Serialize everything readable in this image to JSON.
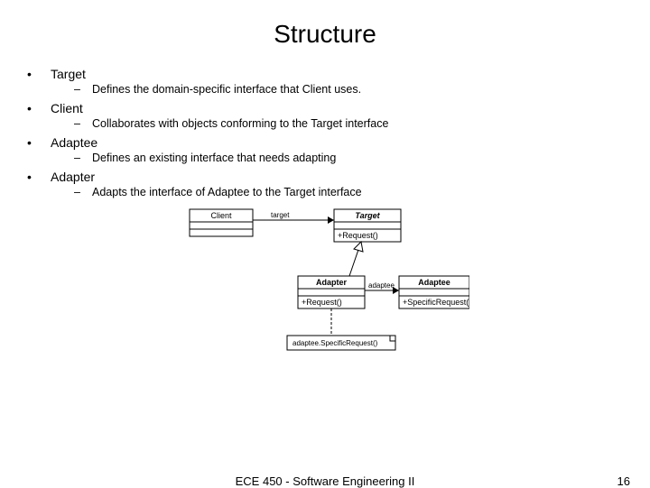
{
  "title": "Structure",
  "items": [
    {
      "term": "Target",
      "desc": "Defines the domain-specific interface that Client uses."
    },
    {
      "term": "Client",
      "desc": "Collaborates with objects conforming to the Target interface"
    },
    {
      "term": "Adaptee",
      "desc": "Defines an existing interface that needs adapting"
    },
    {
      "term": "Adapter",
      "desc": "Adapts the interface of Adaptee to the Target interface"
    }
  ],
  "diagram": {
    "client": "Client",
    "target": "Target",
    "target_op": "+Request()",
    "adapter": "Adapter",
    "adapter_op": "+Request()",
    "adaptee": "Adaptee",
    "adaptee_op": "+SpecificRequest()",
    "assoc_target": "target",
    "assoc_adaptee": "adaptee",
    "note": "adaptee.SpecificRequest()"
  },
  "footer": {
    "course": "ECE 450 - Software Engineering II",
    "page": "16"
  }
}
